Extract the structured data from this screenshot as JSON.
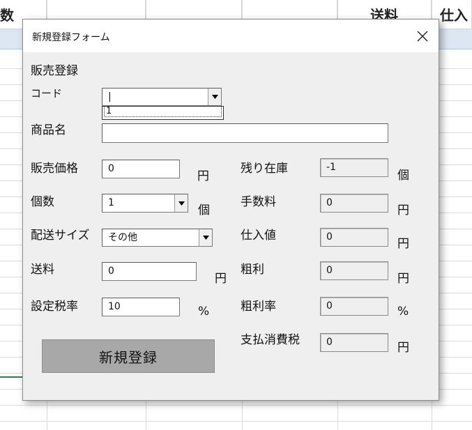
{
  "sheet": {
    "headers": [
      "数",
      "",
      "",
      "",
      "送料",
      "仕入"
    ]
  },
  "dialog": {
    "title": "新規登録フォーム",
    "section_title": "販売登録",
    "code": {
      "label": "コード",
      "value": "|",
      "list_item": "1"
    },
    "product_name": {
      "label": "商品名",
      "value": ""
    },
    "price": {
      "label": "販売価格",
      "value": "0",
      "unit": "円"
    },
    "quantity": {
      "label": "個数",
      "value": "1",
      "unit": "個"
    },
    "shipping_size": {
      "label": "配送サイズ",
      "value": "その他"
    },
    "shipping_cost": {
      "label": "送料",
      "value": "0",
      "unit": "円"
    },
    "tax_rate": {
      "label": "設定税率",
      "value": "10",
      "unit": "%"
    },
    "stock_left": {
      "label": "残り在庫",
      "value": "-1",
      "unit": "個"
    },
    "fee": {
      "label": "手数料",
      "value": "0",
      "unit": "円"
    },
    "cost": {
      "label": "仕入値",
      "value": "0",
      "unit": "円"
    },
    "gross_profit": {
      "label": "粗利",
      "value": "0",
      "unit": "円"
    },
    "margin_rate": {
      "label": "粗利率",
      "value": "0",
      "unit": "%"
    },
    "consumption_tax": {
      "label": "支払消費税",
      "value": "0",
      "unit": "円"
    },
    "register_button": "新規登録"
  },
  "icons": {
    "close": "close-icon",
    "dropdown": "triangle-down-icon"
  }
}
